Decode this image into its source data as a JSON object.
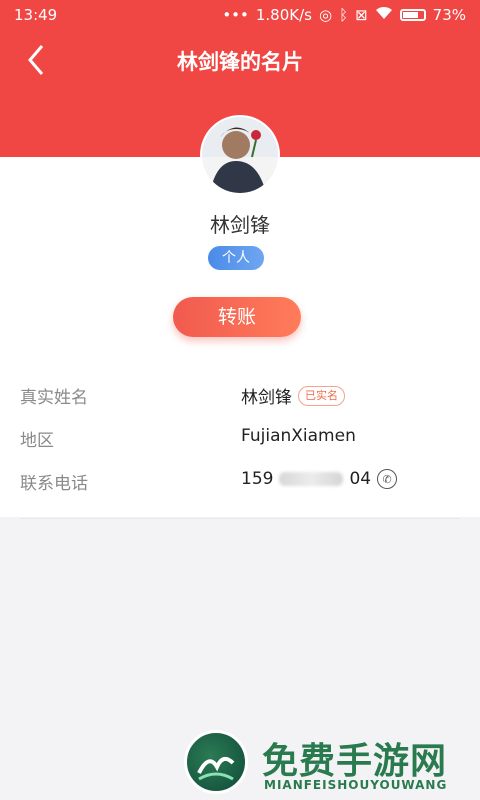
{
  "status_bar": {
    "time": "13:49",
    "network_speed": "1.80K/s",
    "battery_percent": "73%",
    "icons": [
      "signal-dots-icon",
      "headphones-icon",
      "bluetooth-icon",
      "sim-icon",
      "wifi-icon",
      "battery-icon"
    ]
  },
  "header": {
    "title": "林剑锋的名片",
    "back_icon": "back-chevron-icon",
    "color": "#f04745"
  },
  "profile": {
    "name": "林剑锋",
    "type_badge": "个人",
    "transfer_button": "转账"
  },
  "details": [
    {
      "label": "真实姓名",
      "value": "林剑锋",
      "tag": "已实名"
    },
    {
      "label": "地区",
      "value": "FujianXiamen"
    },
    {
      "label": "联系电话",
      "value_prefix": "159",
      "value_suffix": "04",
      "icon": "phone-call-icon"
    }
  ],
  "watermark": {
    "title": "免费手游网",
    "subtitle": "MIANFEISHOUYOUWANG"
  }
}
